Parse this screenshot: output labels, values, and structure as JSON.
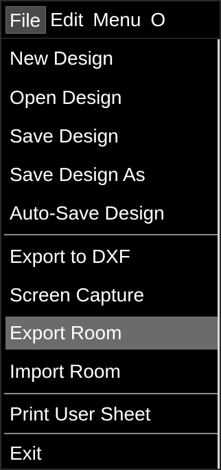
{
  "menubar": {
    "items": [
      {
        "label": "File",
        "active": true
      },
      {
        "label": "Edit",
        "active": false
      },
      {
        "label": "Menu",
        "active": false
      },
      {
        "label": "O",
        "active": false
      }
    ]
  },
  "file_menu": {
    "items": [
      {
        "label": "New Design"
      },
      {
        "label": "Open Design"
      },
      {
        "label": "Save Design"
      },
      {
        "label": "Save Design As"
      },
      {
        "label": "Auto-Save Design"
      },
      {
        "label": "Export to DXF"
      },
      {
        "label": "Screen Capture"
      },
      {
        "label": "Export Room",
        "highlighted": true
      },
      {
        "label": "Import Room"
      },
      {
        "label": "Print User Sheet"
      },
      {
        "label": "Exit"
      }
    ]
  },
  "colors": {
    "background": "#000000",
    "text": "#ffffff",
    "active_menubar": "#4a4a4a",
    "hover_item": "#6b6b6b",
    "separator": "#8c8c8c"
  }
}
